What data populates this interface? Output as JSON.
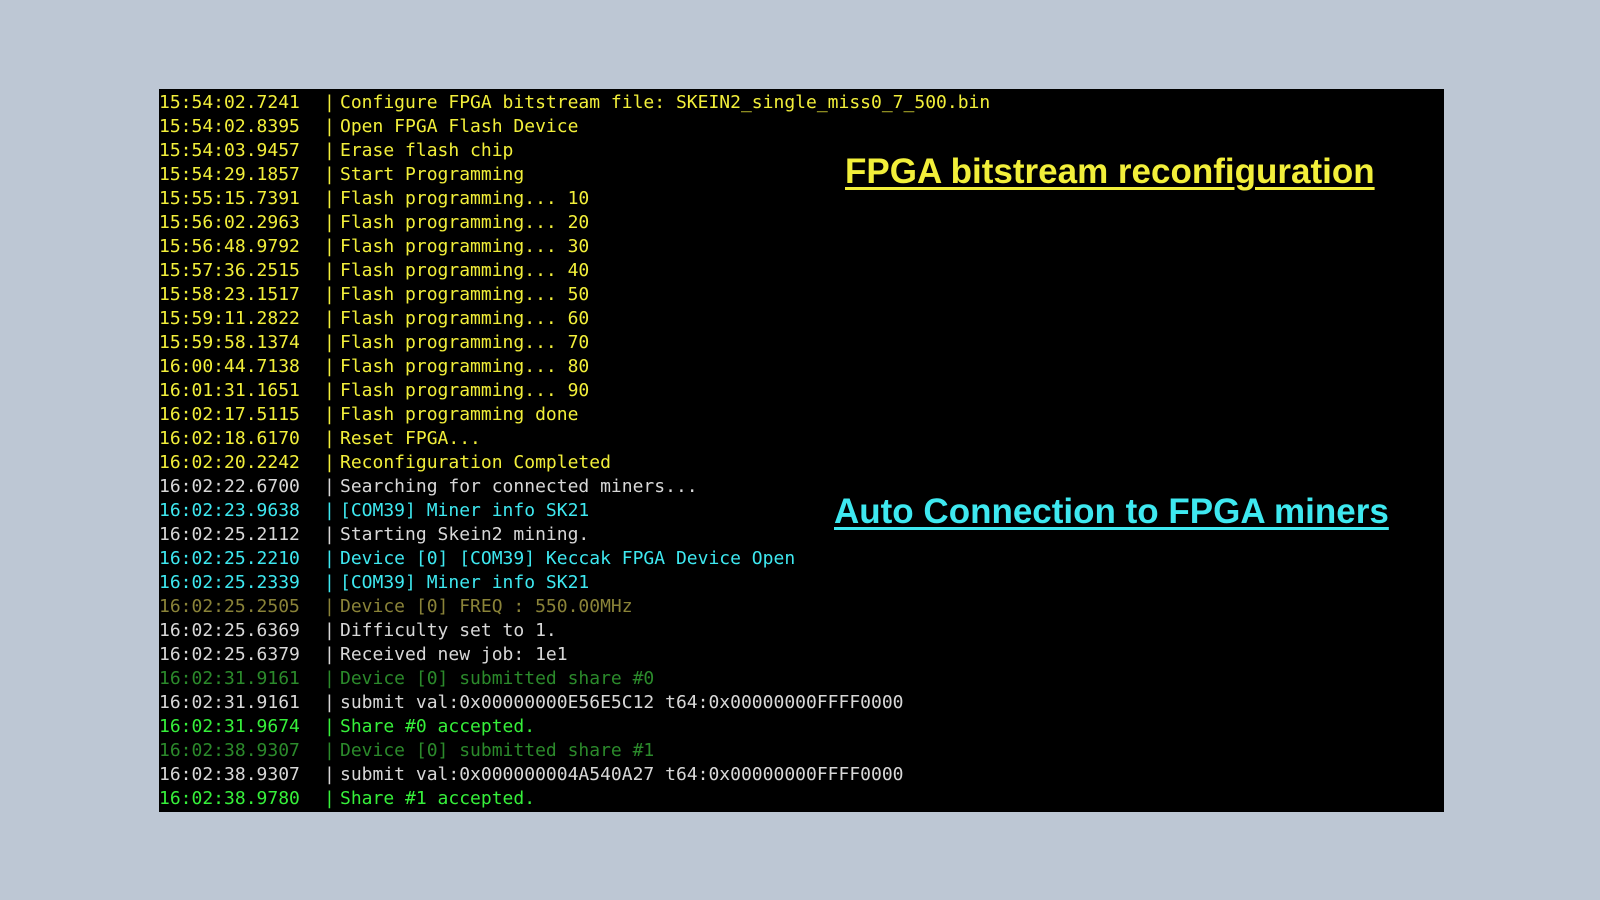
{
  "colors": {
    "background": "#bdc7d4",
    "terminal": "#000000",
    "yellow": "#f2ef3a",
    "white": "#d8d8d8",
    "cyan": "#3ee8f0",
    "olive": "#8a8338",
    "dark_green": "#2b8a2b",
    "green": "#36f03a"
  },
  "annotations": {
    "reconfig": "FPGA bitstream reconfiguration",
    "autoconnect": "Auto Connection to FPGA miners"
  },
  "log": [
    {
      "ts": "15:54:02.7241",
      "msg": "Configure FPGA bitstream file: SKEIN2_single_miss0_7_500.bin",
      "color": "yellow"
    },
    {
      "ts": "15:54:02.8395",
      "msg": "Open FPGA Flash Device",
      "color": "yellow"
    },
    {
      "ts": "15:54:03.9457",
      "msg": "Erase flash chip",
      "color": "yellow"
    },
    {
      "ts": "15:54:29.1857",
      "msg": "Start Programming",
      "color": "yellow"
    },
    {
      "ts": "15:55:15.7391",
      "msg": "Flash programming... 10",
      "color": "yellow"
    },
    {
      "ts": "15:56:02.2963",
      "msg": "Flash programming... 20",
      "color": "yellow"
    },
    {
      "ts": "15:56:48.9792",
      "msg": "Flash programming... 30",
      "color": "yellow"
    },
    {
      "ts": "15:57:36.2515",
      "msg": "Flash programming... 40",
      "color": "yellow"
    },
    {
      "ts": "15:58:23.1517",
      "msg": "Flash programming... 50",
      "color": "yellow"
    },
    {
      "ts": "15:59:11.2822",
      "msg": "Flash programming... 60",
      "color": "yellow"
    },
    {
      "ts": "15:59:58.1374",
      "msg": "Flash programming... 70",
      "color": "yellow"
    },
    {
      "ts": "16:00:44.7138",
      "msg": "Flash programming... 80",
      "color": "yellow"
    },
    {
      "ts": "16:01:31.1651",
      "msg": "Flash programming... 90",
      "color": "yellow"
    },
    {
      "ts": "16:02:17.5115",
      "msg": "Flash programming done",
      "color": "yellow"
    },
    {
      "ts": "16:02:18.6170",
      "msg": "Reset FPGA...",
      "color": "yellow"
    },
    {
      "ts": "16:02:20.2242",
      "msg": "Reconfiguration Completed",
      "color": "yellow"
    },
    {
      "ts": "16:02:22.6700",
      "msg": "Searching for connected miners...",
      "color": "white"
    },
    {
      "ts": "16:02:23.9638",
      "msg": "[COM39] Miner info SK21",
      "color": "cyan"
    },
    {
      "ts": "16:02:25.2112",
      "msg": "Starting Skein2 mining.",
      "color": "white"
    },
    {
      "ts": "16:02:25.2210",
      "msg": "Device [0] [COM39] Keccak FPGA Device Open",
      "color": "cyan"
    },
    {
      "ts": "16:02:25.2339",
      "msg": "[COM39] Miner info SK21",
      "color": "cyan"
    },
    {
      "ts": "16:02:25.2505",
      "msg": "Device [0] FREQ : 550.00MHz",
      "color": "olive"
    },
    {
      "ts": "16:02:25.6369",
      "msg": "Difficulty set to 1.",
      "color": "white"
    },
    {
      "ts": "16:02:25.6379",
      "msg": "Received new job: 1e1",
      "color": "white"
    },
    {
      "ts": "16:02:31.9161",
      "msg": "Device [0] submitted share #0",
      "color": "dkgreen"
    },
    {
      "ts": "16:02:31.9161",
      "msg": "submit val:0x00000000E56E5C12 t64:0x00000000FFFF0000",
      "color": "white"
    },
    {
      "ts": "16:02:31.9674",
      "msg": "Share #0 accepted.",
      "color": "green"
    },
    {
      "ts": "16:02:38.9307",
      "msg": "Device [0] submitted share #1",
      "color": "dkgreen"
    },
    {
      "ts": "16:02:38.9307",
      "msg": "submit val:0x000000004A540A27 t64:0x00000000FFFF0000",
      "color": "white"
    },
    {
      "ts": "16:02:38.9780",
      "msg": "Share #1 accepted.",
      "color": "green"
    }
  ],
  "separator": "|"
}
